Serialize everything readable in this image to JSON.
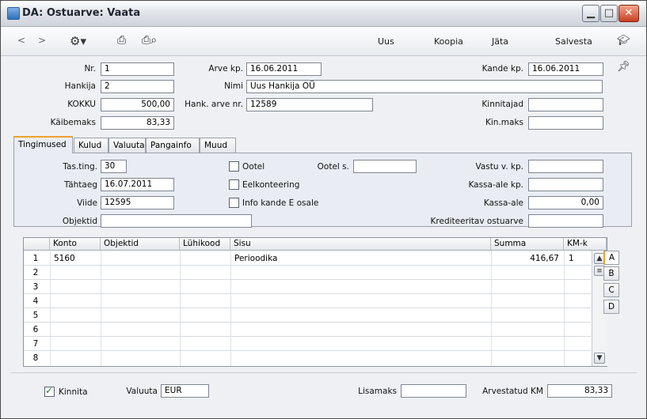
{
  "window": {
    "title": "DA: Ostuarve: Vaata"
  },
  "toolbar": {
    "back": "<",
    "forward": ">",
    "new": "Uus",
    "copy": "Koopia",
    "discard": "Jäta",
    "save": "Salvesta"
  },
  "header": {
    "nr_label": "Nr.",
    "nr": "1",
    "arve_kp_label": "Arve kp.",
    "arve_kp": "16.06.2011",
    "kande_kp_label": "Kande kp.",
    "kande_kp": "16.06.2011",
    "hankija_label": "Hankija",
    "hankija": "2",
    "nimi_label": "Nimi",
    "nimi": "Uus Hankija OÜ",
    "kokku_label": "KOKKU",
    "kokku": "500,00",
    "hank_arve_nr_label": "Hank. arve nr.",
    "hank_arve_nr": "12589",
    "kinnitajad_label": "Kinnitajad",
    "kinnitajad": "",
    "kaibemaks_label": "Käibemaks",
    "kaibemaks": "83,33",
    "kin_maks_label": "Kin.maks",
    "kin_maks": ""
  },
  "tabs": [
    "Tingimused",
    "Kulud",
    "Valuuta",
    "Pangainfo",
    "Muud"
  ],
  "terms": {
    "tas_ting_label": "Tas.ting.",
    "tas_ting": "30",
    "tahtaeg_label": "Tähtaeg",
    "tahtaeg": "16.07.2011",
    "viide_label": "Viide",
    "viide": "12595",
    "objektid_label": "Objektid",
    "objektid": "",
    "ootel_label": "Ootel",
    "eelkonteering_label": "Eelkonteering",
    "info_label": "Info kande E osale",
    "ootel_s_label": "Ootel s.",
    "ootel_s": "",
    "vastu_label": "Vastu v. kp.",
    "vastu": "",
    "kassa_ale_kp_label": "Kassa-ale kp.",
    "kassa_ale_kp": "",
    "kassa_ale_label": "Kassa-ale",
    "kassa_ale": "0,00",
    "krediteeritav_label": "Krediteeritav ostuarve",
    "krediteeritav": ""
  },
  "grid": {
    "columns": [
      "Konto",
      "Objektid",
      "Lühikood",
      "Sisu",
      "Summa",
      "KM-k"
    ],
    "rows": [
      {
        "n": "1",
        "konto": "5160",
        "objektid": "",
        "luhikood": "",
        "sisu": "Perioodika",
        "summa": "416,67",
        "kmk": "1"
      },
      {
        "n": "2"
      },
      {
        "n": "3"
      },
      {
        "n": "4"
      },
      {
        "n": "5"
      },
      {
        "n": "6"
      },
      {
        "n": "7"
      },
      {
        "n": "8"
      }
    ],
    "side_tabs": [
      "A",
      "B",
      "C",
      "D"
    ]
  },
  "footer": {
    "kinnita_label": "Kinnita",
    "valuuta_label": "Valuuta",
    "valuuta": "EUR",
    "lisamaks_label": "Lisamaks",
    "lisamaks": "",
    "arvestatud_km_label": "Arvestatud KM",
    "arvestatud_km": "83,33"
  }
}
